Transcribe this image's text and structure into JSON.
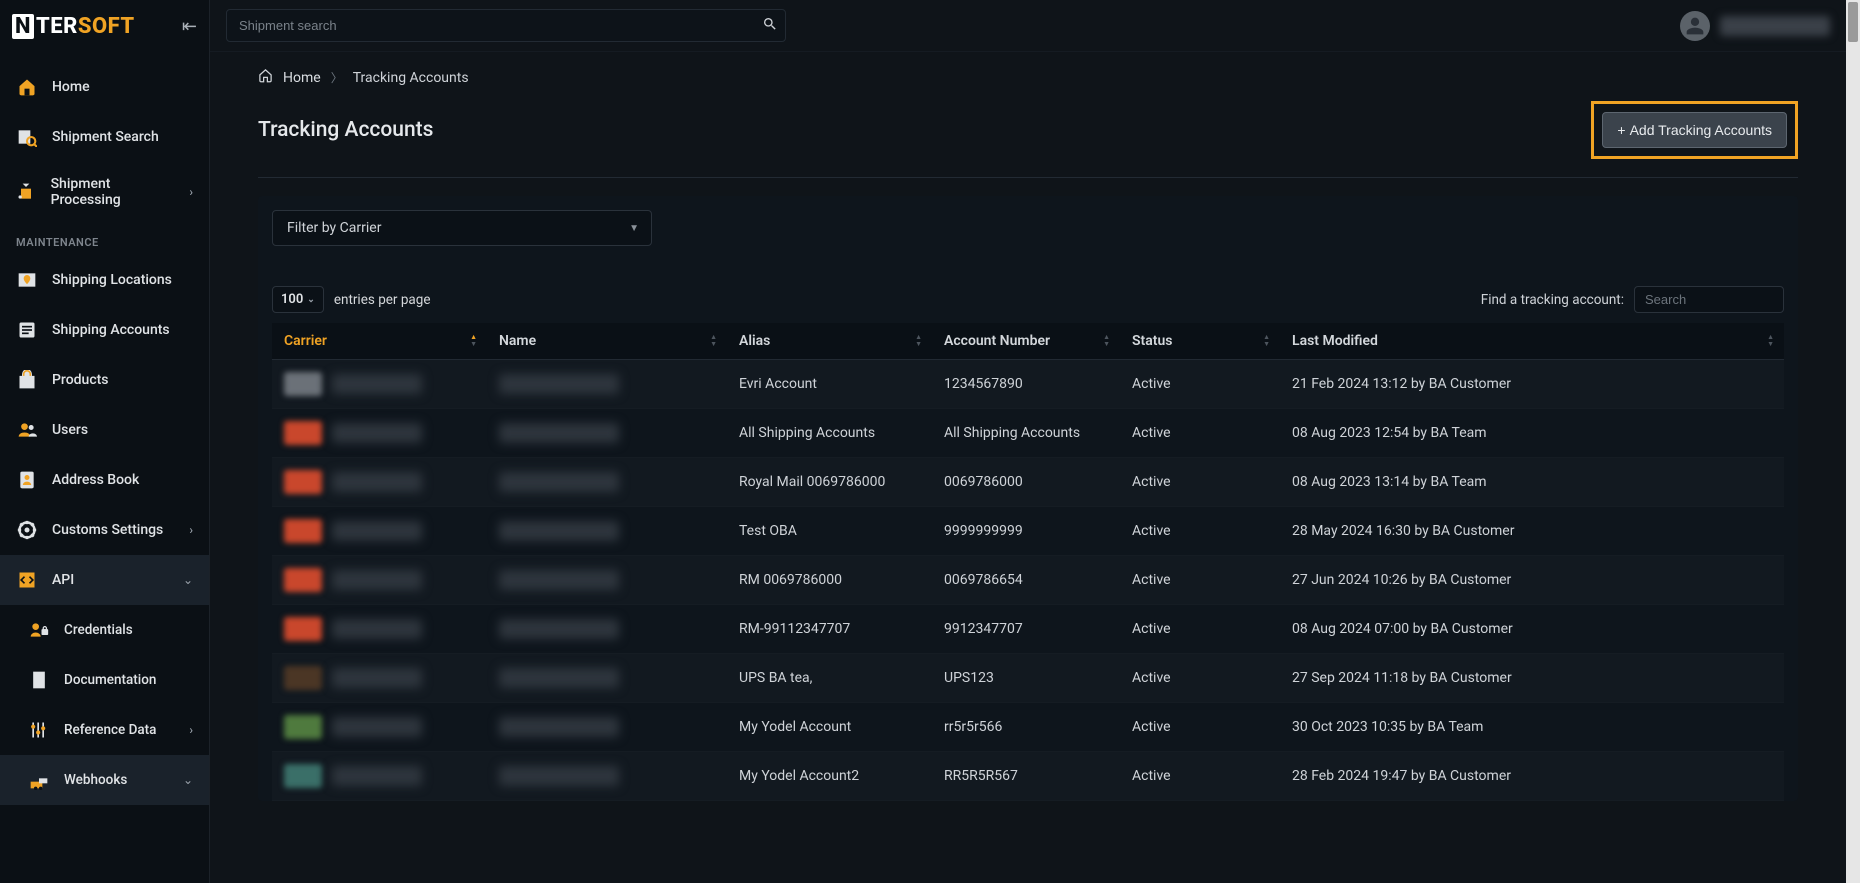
{
  "brand": {
    "prefix": "N",
    "mid": "TER",
    "suffix": "SOFT"
  },
  "topbar": {
    "search_placeholder": "Shipment search"
  },
  "sidebar": {
    "items_top": [
      {
        "key": "home",
        "label": "Home"
      },
      {
        "key": "shipment-search",
        "label": "Shipment Search"
      },
      {
        "key": "shipment-processing",
        "label": "Shipment Processing",
        "chevron": true
      }
    ],
    "maintenance_heading": "MAINTENANCE",
    "items_maint": [
      {
        "key": "shipping-locations",
        "label": "Shipping Locations"
      },
      {
        "key": "shipping-accounts",
        "label": "Shipping Accounts"
      },
      {
        "key": "products",
        "label": "Products"
      },
      {
        "key": "users",
        "label": "Users"
      },
      {
        "key": "address-book",
        "label": "Address Book"
      },
      {
        "key": "customs-settings",
        "label": "Customs Settings",
        "chevron": true
      },
      {
        "key": "api",
        "label": "API",
        "chevron_down": true
      }
    ],
    "api_sub": [
      {
        "key": "credentials",
        "label": "Credentials"
      },
      {
        "key": "documentation",
        "label": "Documentation"
      },
      {
        "key": "reference-data",
        "label": "Reference Data",
        "chevron": true
      },
      {
        "key": "webhooks",
        "label": "Webhooks",
        "chevron_down": true
      }
    ]
  },
  "breadcrumb": {
    "home": "Home",
    "current": "Tracking Accounts"
  },
  "page": {
    "title": "Tracking Accounts",
    "add_button": "Add Tracking Accounts"
  },
  "filter": {
    "label": "Filter by Carrier"
  },
  "table": {
    "pagesize": "100",
    "entries_label": "entries per page",
    "find_label": "Find a tracking account:",
    "find_placeholder": "Search",
    "headers": {
      "carrier": "Carrier",
      "name": "Name",
      "alias": "Alias",
      "account": "Account Number",
      "status": "Status",
      "modified": "Last Modified"
    },
    "rows": [
      {
        "logo": "cl-grey",
        "alias": "Evri Account",
        "account": "1234567890",
        "status": "Active",
        "modified": "21 Feb 2024 13:12 by BA Customer"
      },
      {
        "logo": "cl-red",
        "alias": "All Shipping Accounts",
        "account": "All Shipping Accounts",
        "status": "Active",
        "modified": "08 Aug 2023 12:54 by BA Team"
      },
      {
        "logo": "cl-red",
        "alias": "Royal Mail 0069786000",
        "account": "0069786000",
        "status": "Active",
        "modified": "08 Aug 2023 13:14 by BA Team"
      },
      {
        "logo": "cl-red",
        "alias": "Test OBA",
        "account": "9999999999",
        "status": "Active",
        "modified": "28 May 2024 16:30 by BA Customer"
      },
      {
        "logo": "cl-red",
        "alias": "RM 0069786000",
        "account": "0069786654",
        "status": "Active",
        "modified": "27 Jun 2024 10:26 by BA Customer"
      },
      {
        "logo": "cl-red",
        "alias": "RM-99112347707",
        "account": "9912347707",
        "status": "Active",
        "modified": "08 Aug 2024 07:00 by BA Customer"
      },
      {
        "logo": "cl-brown",
        "alias": "UPS BA tea,",
        "account": "UPS123",
        "status": "Active",
        "modified": "27 Sep 2024 11:18 by BA Customer"
      },
      {
        "logo": "cl-green",
        "alias": "My Yodel Account",
        "account": "rr5r5r566",
        "status": "Active",
        "modified": "30 Oct 2023 10:35 by BA Team"
      },
      {
        "logo": "cl-teal",
        "alias": "My Yodel Account2",
        "account": "RR5R5R567",
        "status": "Active",
        "modified": "28 Feb 2024 19:47 by BA Customer"
      }
    ]
  }
}
